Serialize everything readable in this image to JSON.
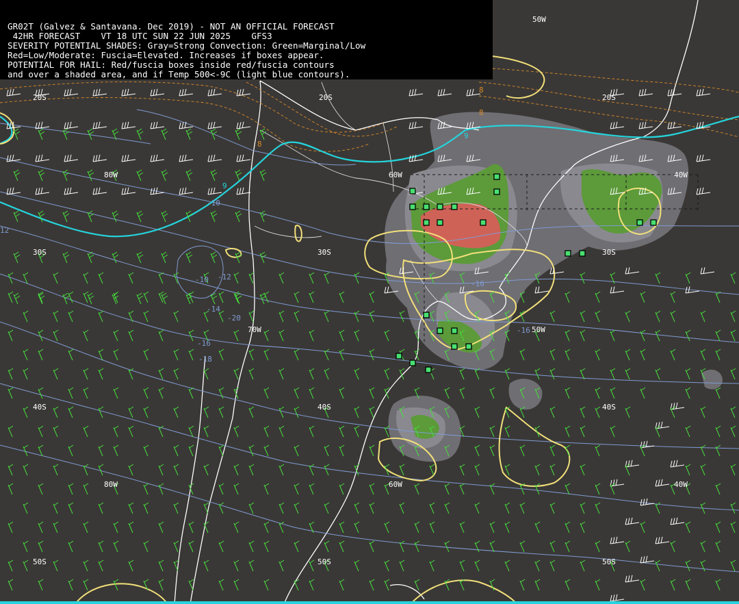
{
  "header": {
    "lines": [
      "GR02T (Galvez & Santavana. Dec 2019) - NOT AN OFFICIAL FORECAST",
      " 42HR FORECAST    VT 18 UTC SUN 22 JUN 2025    GFS3",
      "SEVERITY POTENTIAL SHADES: Gray=Strong Convection: Green=Marginal/Low",
      "Red=Low/Moderate: Fuscia=Elevated. Increases if boxes appear.",
      "POTENTIAL FOR HAIL: Red/fuscia boxes inside red/fuscia contours",
      "and over a shaded area, and if Temp 500<-9C (light blue contours)."
    ]
  },
  "grid_labels": {
    "lon_80w_a": "80W",
    "lon_60w_a": "60W",
    "lon_40w_a": "40W",
    "lon_70w": "70W",
    "lon_50w": "50W",
    "lon_80w_b": "80W",
    "lon_60w_b": "60W",
    "lon_40w_b": "40W",
    "lon_50w_top": "50W",
    "lat_20s_a": "20S",
    "lat_20s_b": "20S",
    "lat_20s_c": "20S",
    "lat_30s_a": "30S",
    "lat_30s_b": "30S",
    "lat_30s_c": "30S",
    "lat_40s_a": "40S",
    "lat_40s_b": "40S",
    "lat_40s_c": "40S",
    "lat_50s_a": "50S",
    "lat_50s_b": "50S",
    "lat_50s_c": "50S"
  },
  "contour_labels": {
    "t500_a": "-10",
    "t500_b": "-12",
    "t500_c": "-10",
    "t500_d": "-12",
    "t500_e": "-14",
    "t500_f": "-20",
    "t500_g": "-16",
    "t500_h": "-18",
    "t500_i": "12",
    "t500_j": "-16",
    "t500_k": "-16",
    "cyan_a": "9",
    "cyan_b": "9",
    "orange_a": "8",
    "orange_b": "8",
    "orange_c": "8"
  },
  "colors": {
    "background": "#3a3836",
    "gray_strong": "#6f6e73",
    "gray_light": "#8a898f",
    "green_marginal": "#5c9a3a",
    "red_lowmod": "#cf6257",
    "yellow_contour": "#f2e07a",
    "cyan_contour": "#25d4dc",
    "lightblue_temp": "#7f9bd3",
    "orange_dashed": "#d98a2a",
    "wind_green": "#45e03c",
    "wind_white": "#ffffff",
    "box_green": "#48e070"
  },
  "hail_boxes_count": 22
}
